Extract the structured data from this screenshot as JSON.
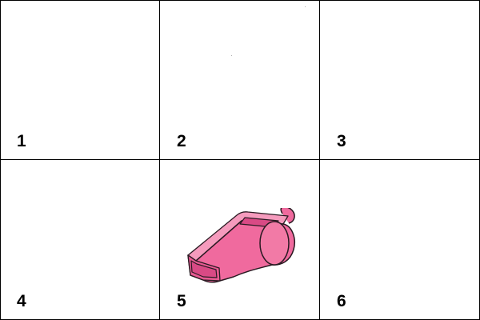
{
  "cells": [
    {
      "number": "1",
      "content": ""
    },
    {
      "number": "2",
      "content": ""
    },
    {
      "number": "3",
      "content": ""
    },
    {
      "number": "4",
      "content": ""
    },
    {
      "number": "5",
      "content": "whistle-icon"
    },
    {
      "number": "6",
      "content": ""
    }
  ],
  "colors": {
    "whistle_fill": "#f06a9e",
    "whistle_dark": "#d94a85",
    "whistle_outline": "#2a1a22",
    "grid_line": "#000000"
  }
}
